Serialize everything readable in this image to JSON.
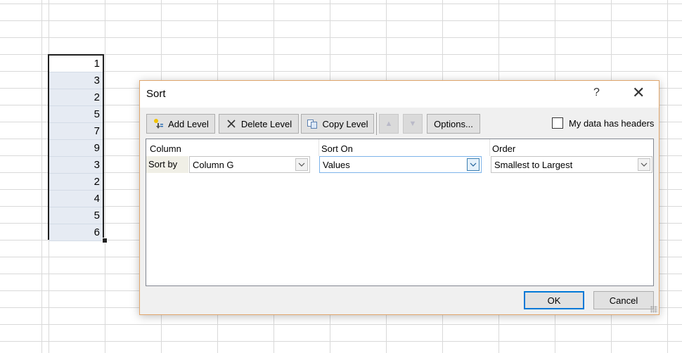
{
  "sheet": {
    "values": [
      "1",
      "3",
      "2",
      "5",
      "7",
      "9",
      "3",
      "2",
      "4",
      "5",
      "6"
    ]
  },
  "dialog": {
    "title": "Sort",
    "help_label": "?",
    "close_label": "✕",
    "toolbar": {
      "add_level": "Add Level",
      "delete_level": "Delete Level",
      "copy_level": "Copy Level",
      "move_up_icon": "arrow-up-icon",
      "move_down_icon": "arrow-down-icon",
      "options": "Options..."
    },
    "headers_checkbox": {
      "label": "My data has headers",
      "checked": false
    },
    "columns": {
      "column": "Column",
      "sort_on": "Sort On",
      "order": "Order"
    },
    "row": {
      "label": "Sort by",
      "column_value": "Column G",
      "sort_on_value": "Values",
      "order_value": "Smallest to Largest"
    },
    "ok_label": "OK",
    "cancel_label": "Cancel"
  }
}
